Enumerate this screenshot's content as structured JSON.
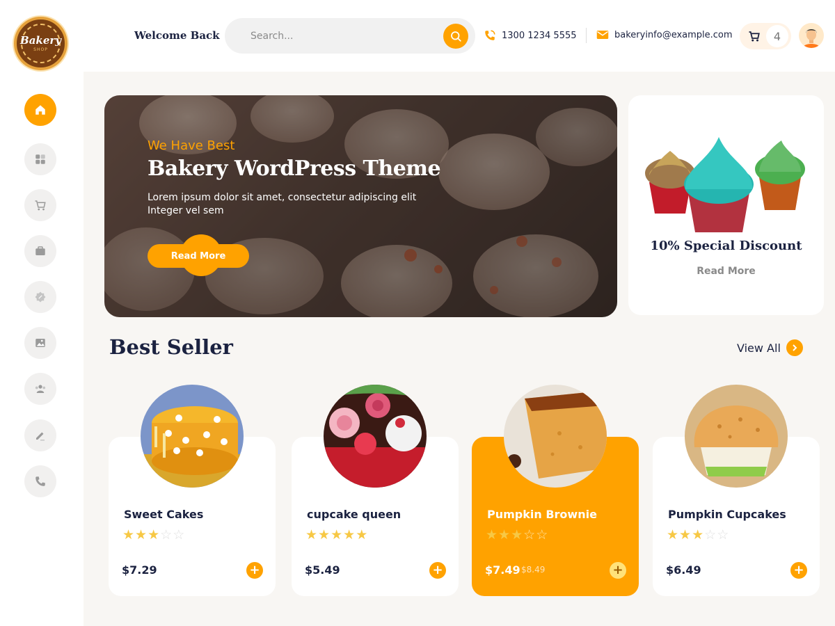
{
  "logo": {
    "title": "Bakery",
    "subtitle": "SHOP"
  },
  "sidebar": {
    "items": [
      {
        "name": "home",
        "icon": "home-icon",
        "active": true
      },
      {
        "name": "dashboard",
        "icon": "grid-icon",
        "active": false
      },
      {
        "name": "cart",
        "icon": "cart-icon",
        "active": false
      },
      {
        "name": "portfolio",
        "icon": "briefcase-icon",
        "active": false
      },
      {
        "name": "offers",
        "icon": "discount-badge-icon",
        "active": false
      },
      {
        "name": "gallery",
        "icon": "image-icon",
        "active": false
      },
      {
        "name": "team",
        "icon": "users-icon",
        "active": false
      },
      {
        "name": "blog",
        "icon": "edit-icon",
        "active": false
      },
      {
        "name": "contact",
        "icon": "phone-icon",
        "active": false
      }
    ]
  },
  "header": {
    "welcome": "Welcome Back",
    "search_placeholder": "Search...",
    "phone": "1300 1234 5555",
    "email": "bakeryinfo@example.com",
    "cart_count": "4"
  },
  "hero": {
    "tagline": "We Have Best",
    "title": "Bakery WordPress Theme",
    "text": "Lorem ipsum dolor sit amet, consectetur adipiscing elit Integer vel sem",
    "button": "Read More"
  },
  "promo": {
    "title": "10% Special Discount",
    "link": "Read More"
  },
  "best_seller": {
    "title": "Best Seller",
    "view_all": "View All",
    "products": [
      {
        "name": "Sweet Cakes",
        "rating": 3,
        "price": "$7.29",
        "old_price": ""
      },
      {
        "name": "cupcake queen",
        "rating": 5,
        "price": "$5.49",
        "old_price": ""
      },
      {
        "name": "Pumpkin Brownie",
        "rating": 3,
        "price": "$7.49",
        "old_price": "$8.49",
        "featured": true
      },
      {
        "name": "Pumpkin Cupcakes",
        "rating": 3,
        "price": "$6.49",
        "old_price": ""
      }
    ]
  },
  "colors": {
    "accent": "#ffa200",
    "dark": "#1b2240"
  }
}
